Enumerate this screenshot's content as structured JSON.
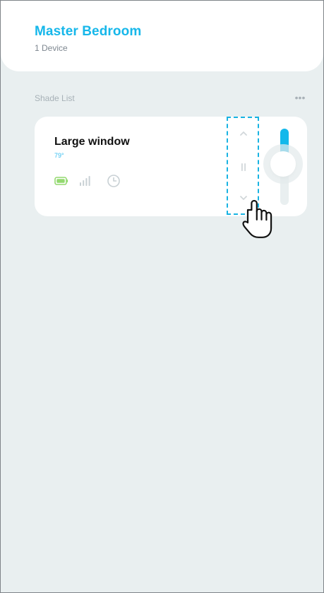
{
  "header": {
    "title": "Master Bedroom",
    "subtitle": "1 Device"
  },
  "section": {
    "label": "Shade List",
    "more_icon": "more-horizontal-icon"
  },
  "card": {
    "name": "Large window",
    "temperature": "79°",
    "status_icons": [
      "battery-icon",
      "signal-icon",
      "clock-icon"
    ],
    "controls": {
      "up_icon": "chevron-up-icon",
      "pause_icon": "pause-icon",
      "down_icon": "chevron-down-icon"
    },
    "slider": {
      "level_fraction": 0.4
    }
  },
  "colors": {
    "accent": "#12b8eb",
    "background": "#e9eff0",
    "battery": "#93d96f",
    "muted": "#c8d0d4"
  }
}
